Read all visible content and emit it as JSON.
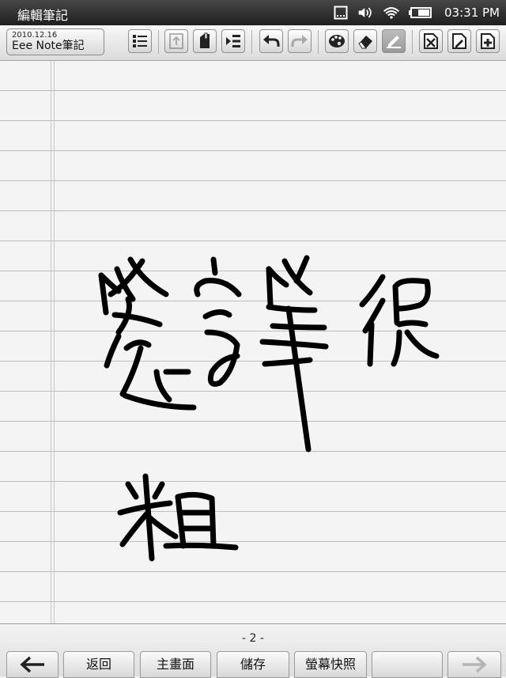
{
  "status_bar": {
    "title": "編輯筆記",
    "time": "03:31 PM",
    "icons": [
      "sd-card-icon",
      "volume-icon",
      "wifi-icon",
      "battery-icon"
    ]
  },
  "toolbar": {
    "note_date": "2010.12.16",
    "note_name": "Eee Note筆記",
    "buttons": [
      "list-view",
      "export",
      "clip",
      "indent",
      "undo",
      "redo",
      "palette",
      "eraser",
      "pen",
      "delete-page",
      "edit-page",
      "add-page"
    ]
  },
  "page": {
    "number_text": "- 2 -",
    "ruled_lines": true
  },
  "footer": {
    "back_label": "返回",
    "home_label": "主畫面",
    "save_label": "儲存",
    "screenshot_label": "螢幕快照",
    "empty_label": ""
  }
}
